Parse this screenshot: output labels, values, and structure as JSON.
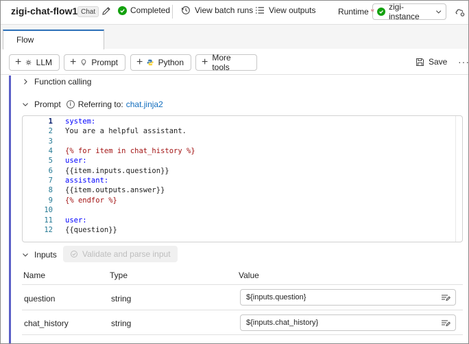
{
  "header": {
    "flow_name": "zigi-chat-flow1",
    "flow_type_tag": "Chat",
    "status": "Completed",
    "view_batch_runs": "View batch runs",
    "view_outputs": "View outputs",
    "runtime_label": "Runtime",
    "runtime_required_mark": "*",
    "runtime_value": "zigi-instance"
  },
  "tabs": [
    {
      "label": "Flow"
    }
  ],
  "toolbar": {
    "llm": "LLM",
    "prompt": "Prompt",
    "python": "Python",
    "more_tools": "More tools",
    "save": "Save",
    "more": "···"
  },
  "node": {
    "collapsed_section": "Function calling",
    "prompt_section": "Prompt",
    "referring_to_label": "Referring to:",
    "referring_to_file": "chat.jinja2",
    "code_lines": [
      {
        "n": "1",
        "text": "system:"
      },
      {
        "n": "2",
        "text": "You are a helpful assistant."
      },
      {
        "n": "3",
        "text": ""
      },
      {
        "n": "4",
        "text": "{% for item in chat_history %}"
      },
      {
        "n": "5",
        "text": "user:"
      },
      {
        "n": "6",
        "text": "{{item.inputs.question}}"
      },
      {
        "n": "7",
        "text": "assistant:"
      },
      {
        "n": "8",
        "text": "{{item.outputs.answer}}"
      },
      {
        "n": "9",
        "text": "{% endfor %}"
      },
      {
        "n": "10",
        "text": ""
      },
      {
        "n": "11",
        "text": "user:"
      },
      {
        "n": "12",
        "text": "{{question}}"
      }
    ],
    "inputs_section": "Inputs",
    "validate_button": "Validate and parse input",
    "table": {
      "columns": [
        "Name",
        "Type",
        "Value"
      ],
      "rows": [
        {
          "name": "question",
          "type": "string",
          "value": "${inputs.question}"
        },
        {
          "name": "chat_history",
          "type": "string",
          "value": "${inputs.chat_history}"
        }
      ]
    }
  },
  "colors": {
    "accent": "#0f6cbd",
    "success": "#13a10e",
    "node_border": "#5b5fc7"
  }
}
